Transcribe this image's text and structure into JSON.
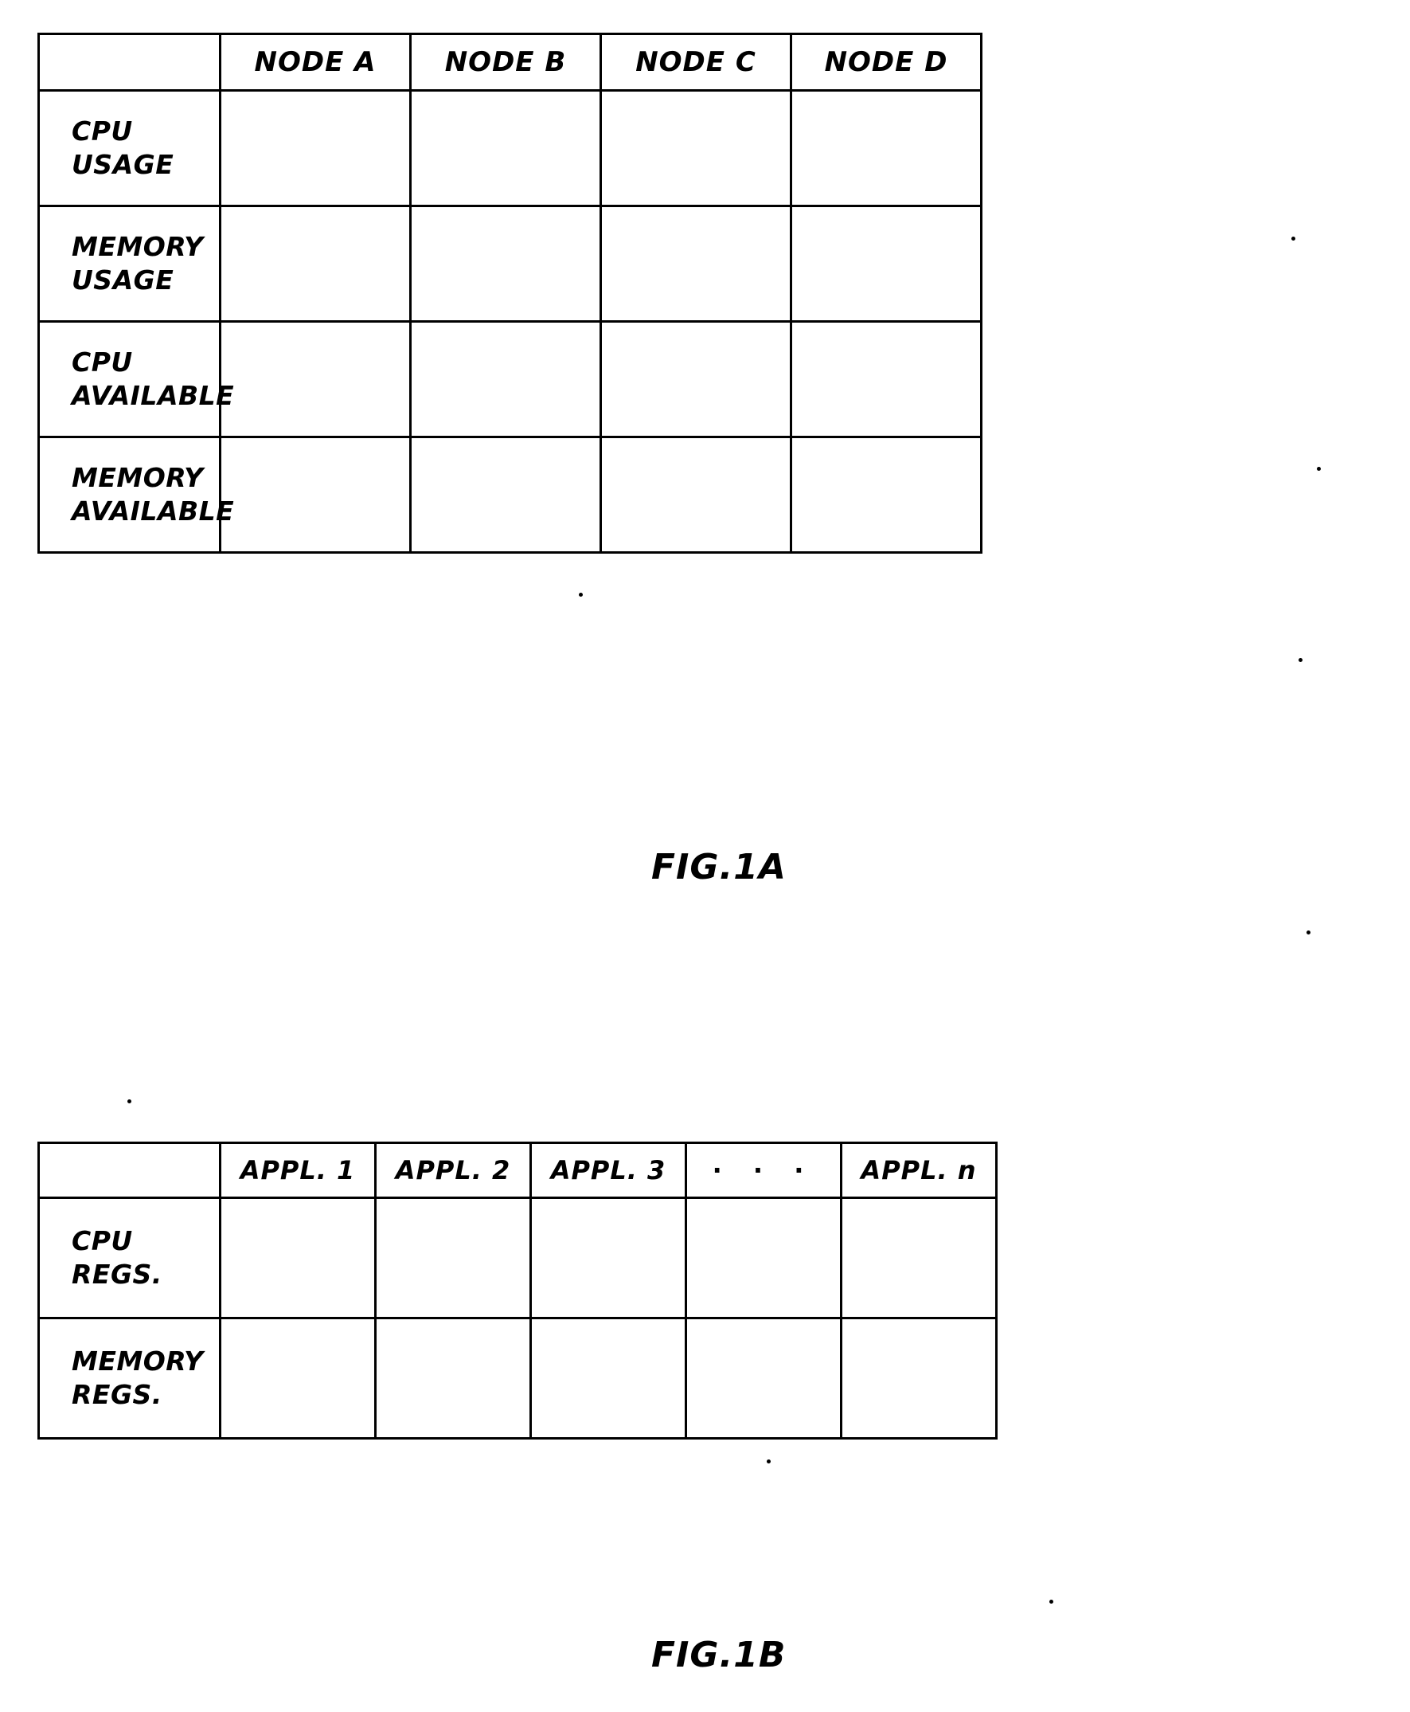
{
  "document": {
    "type": "patent-figure-sheet",
    "page_background": "#ffffff",
    "ink_color": "#000000"
  },
  "figures": [
    {
      "id": "fig-1a",
      "caption": "FIG.1A",
      "table": {
        "corner_label": "",
        "column_headers": [
          "NODE A",
          "NODE B",
          "NODE C",
          "NODE D"
        ],
        "row_labels": [
          {
            "line1": "CPU",
            "line2": "USAGE"
          },
          {
            "line1": "MEMORY",
            "line2": "USAGE"
          },
          {
            "line1": "CPU",
            "line2": "AVAILABLE"
          },
          {
            "line1": "MEMORY",
            "line2": "AVAILABLE"
          }
        ],
        "cells": [
          [
            "",
            "",
            "",
            ""
          ],
          [
            "",
            "",
            "",
            ""
          ],
          [
            "",
            "",
            "",
            ""
          ],
          [
            "",
            "",
            "",
            ""
          ]
        ]
      }
    },
    {
      "id": "fig-1b",
      "caption": "FIG.1B",
      "table": {
        "corner_label": "",
        "column_headers": [
          "APPL. 1",
          "APPL. 2",
          "APPL. 3",
          "·  ·  ·",
          "APPL. n"
        ],
        "row_labels": [
          {
            "line1": "CPU",
            "line2": "REGS."
          },
          {
            "line1": "MEMORY",
            "line2": "REGS."
          }
        ],
        "cells": [
          [
            "",
            "",
            "",
            "",
            ""
          ],
          [
            "",
            "",
            "",
            "",
            ""
          ]
        ]
      }
    }
  ]
}
